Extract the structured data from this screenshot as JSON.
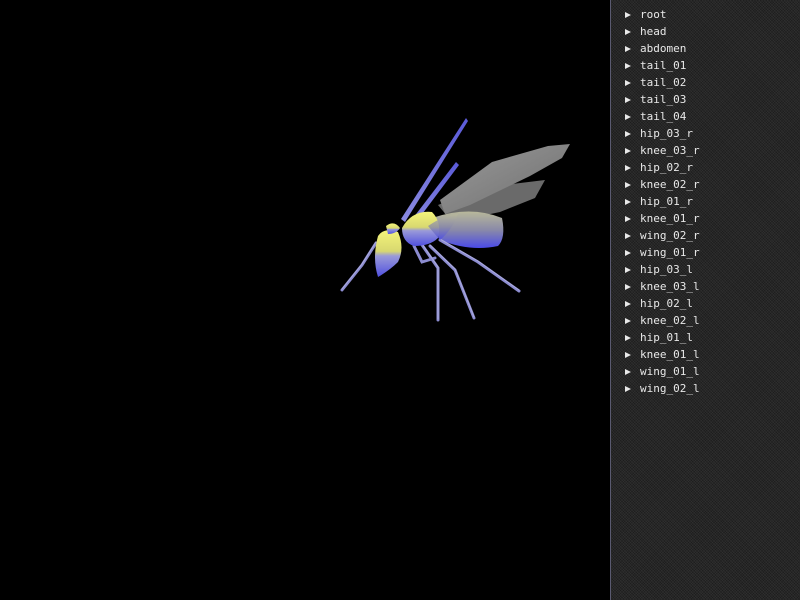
{
  "scene": {
    "model": "wasp",
    "colors": {
      "background": "#000000",
      "body_top": "#f0f070",
      "body_bottom": "#5a5ae0",
      "wing": "#8a8a8a",
      "leg": "#8888cc"
    }
  },
  "bone_panel": {
    "expand_icon": "triangle-right-icon",
    "bones": [
      "root",
      "head",
      "abdomen",
      "tail_01",
      "tail_02",
      "tail_03",
      "tail_04",
      "hip_03_r",
      "knee_03_r",
      "hip_02_r",
      "knee_02_r",
      "hip_01_r",
      "knee_01_r",
      "wing_02_r",
      "wing_01_r",
      "hip_03_l",
      "knee_03_l",
      "hip_02_l",
      "knee_02_l",
      "hip_01_l",
      "knee_01_l",
      "wing_01_l",
      "wing_02_l"
    ]
  }
}
